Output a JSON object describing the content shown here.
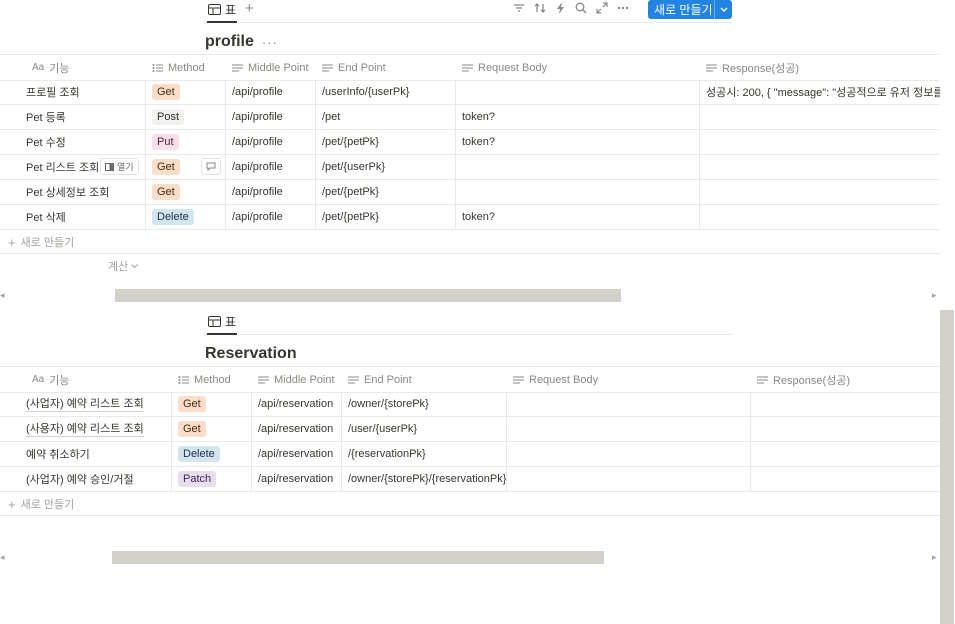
{
  "toolbar": {
    "view_label": "표",
    "add_view": "+",
    "new_button": "새로 만들기",
    "icons": [
      "filter-icon",
      "sort-icon",
      "automation-icon",
      "search-icon",
      "expand-icon",
      "more-icon"
    ]
  },
  "profile": {
    "title": "profile",
    "more": "···",
    "columns": [
      "기능",
      "Method",
      "Middle Point",
      "End Point",
      "Request Body",
      "Response(성공)"
    ],
    "title_col_prefix": "Aa",
    "rows": [
      {
        "name": "프로필 조회",
        "method": "Get",
        "middle": "/api/profile",
        "end": "/userInfo/{userPk}",
        "body": "",
        "response": "성공시: 200, { \"message\": \"성공적으로 유저 정보를"
      },
      {
        "name": "Pet 등록",
        "method": "Post",
        "middle": "/api/profile",
        "end": "/pet",
        "body": "token?",
        "response": ""
      },
      {
        "name": "Pet 수정",
        "method": "Put",
        "middle": "/api/profile",
        "end": "/pet/{petPk}",
        "body": "token?",
        "response": ""
      },
      {
        "name": "Pet 리스트 조회",
        "method": "Get",
        "middle": "/api/profile",
        "end": "/pet/{userPk}",
        "body": "",
        "response": ""
      },
      {
        "name": "Pet 상세정보 조회",
        "method": "Get",
        "middle": "/api/profile",
        "end": "/pet/{petPk}",
        "body": "",
        "response": ""
      },
      {
        "name": "Pet 삭제",
        "method": "Delete",
        "middle": "/api/profile",
        "end": "/pet/{petPk}",
        "body": "token?",
        "response": ""
      }
    ],
    "open_label": "열기",
    "add_row": "새로 만들기",
    "calc": "계산"
  },
  "reservation": {
    "view_label": "표",
    "title": "Reservation",
    "columns": [
      "기능",
      "Method",
      "Middle Point",
      "End Point",
      "Request Body",
      "Response(성공)"
    ],
    "title_col_prefix": "Aa",
    "rows": [
      {
        "name": "(사업자) 예약 리스트 조회",
        "method": "Get",
        "middle": "/api/reservation",
        "end": "/owner/{storePk}",
        "body": "",
        "response": ""
      },
      {
        "name": "(사용자) 예약 리스트 조회",
        "method": "Get",
        "middle": "/api/reservation",
        "end": "/user/{userPk}",
        "body": "",
        "response": ""
      },
      {
        "name": "예약 취소하기",
        "method": "Delete",
        "middle": "/api/reservation",
        "end": "/{reservationPk}",
        "body": "",
        "response": ""
      },
      {
        "name": "(사업자) 예약 승인/거절",
        "method": "Patch",
        "middle": "/api/reservation",
        "end": "/owner/{storePk}/{reservationPk}",
        "body": "",
        "response": ""
      }
    ],
    "add_row": "새로 만들기"
  },
  "method_colors": {
    "Get": {
      "bg": "#fadec9",
      "fg": "#49290e"
    },
    "Post": {
      "bg": "#f1f1ef",
      "fg": "#32302c"
    },
    "Put": {
      "bg": "#f9dfe9",
      "fg": "#4c2337"
    },
    "Delete": {
      "bg": "#d3e5ef",
      "fg": "#183347"
    },
    "Patch": {
      "bg": "#e8deee",
      "fg": "#412454"
    }
  },
  "colors": {
    "accent": "#2383e2",
    "border": "#e9e9e7",
    "muted": "#8a8985",
    "scrollbar": "#d3d1cb"
  }
}
